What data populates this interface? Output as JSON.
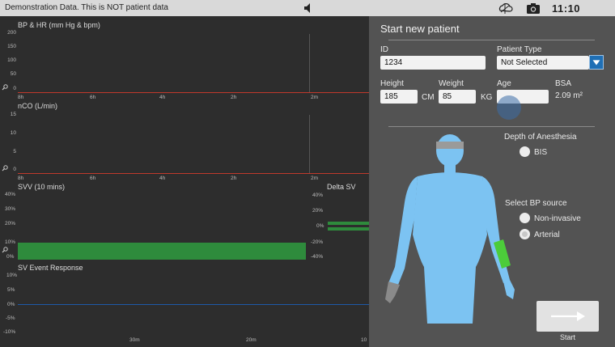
{
  "status_bar": {
    "banner": "Demonstration Data. This is NOT patient data",
    "icons": [
      "speaker-icon",
      "cloud-connection-icon",
      "camera-icon"
    ],
    "clock": "11:10"
  },
  "charts": {
    "bp_hr": {
      "title": "BP & HR (mm Hg & bpm)",
      "y_ticks": [
        "200",
        "150",
        "100",
        "50",
        "0"
      ],
      "x_ticks": [
        "8h",
        "6h",
        "4h",
        "2h",
        "2m"
      ]
    },
    "nco": {
      "title": "nCO (L/min)",
      "y_ticks": [
        "15",
        "10",
        "5",
        "0"
      ],
      "x_ticks": [
        "8h",
        "6h",
        "4h",
        "2h",
        "2m"
      ]
    },
    "svv": {
      "title": "SVV (10 mins)",
      "y_ticks": [
        "40%",
        "30%",
        "20%",
        "10%",
        "0%"
      ]
    },
    "delta_sv": {
      "title": "Delta SV",
      "y_ticks": [
        "40%",
        "20%",
        "0%",
        "-20%",
        "-40%"
      ]
    },
    "sv_event": {
      "title": "SV Event Response",
      "y_ticks": [
        "10%",
        "5%",
        "0%",
        "-5%",
        "-10%"
      ],
      "x_ticks": [
        "30m",
        "20m",
        "10"
      ]
    }
  },
  "panel": {
    "title": "Start new patient",
    "id_label": "ID",
    "id_value": "1234",
    "patient_type_label": "Patient Type",
    "patient_type_value": "Not Selected",
    "height_label": "Height",
    "height_value": "185",
    "height_unit": "CM",
    "weight_label": "Weight",
    "weight_value": "85",
    "weight_unit": "KG",
    "age_label": "Age",
    "age_value": "",
    "bsa_label": "BSA",
    "bsa_value": "2.09 m²",
    "depth_label": "Depth of Anesthesia",
    "bis_label": "BIS",
    "bp_source_label": "Select BP source",
    "noninvasive_label": "Non-invasive",
    "arterial_label": "Arterial",
    "bp_source_selected": "Arterial",
    "start_label": "Start"
  },
  "colors": {
    "accent_blue": "#1f6fb5",
    "body_blue": "#7cc3f2",
    "cuff_green": "#4ccc3a",
    "threshold_red": "#c0392b",
    "svv_green": "#2e8b3c"
  }
}
